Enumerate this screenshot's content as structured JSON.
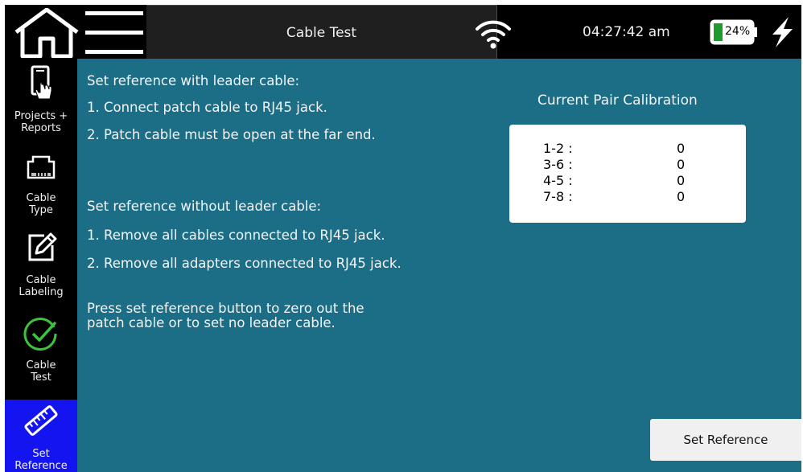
{
  "header": {
    "title": "Cable Test",
    "time": "04:27:42 am",
    "battery_percent": "24%",
    "battery_level": 0.24,
    "icons": [
      "home-icon",
      "hamburger-menu-icon",
      "wifi-icon",
      "battery-icon",
      "charging-bolt-icon"
    ]
  },
  "sidebar": {
    "items": [
      {
        "label": "Projects + Reports",
        "icon": "projects-reports-icon"
      },
      {
        "label": "Cable Type",
        "icon": "rj45-jack-icon"
      },
      {
        "label": "Cable Labeling",
        "icon": "edit-label-icon"
      },
      {
        "label": "Cable Test",
        "icon": "check-circle-icon"
      },
      {
        "label": "Set Reference",
        "icon": "ruler-icon",
        "active": true
      }
    ]
  },
  "instructions": {
    "with_leader_heading": "Set reference with leader cable:",
    "with_leader_step1": "1. Connect patch cable to RJ45 jack.",
    "with_leader_step2": "2. Patch cable must be open at the far end.",
    "without_leader_heading": "Set reference without leader cable:",
    "without_leader_step1": "1. Remove all cables connected to RJ45 jack.",
    "without_leader_step2": "2. Remove all adapters connected to RJ45 jack.",
    "note_line1": "Press set reference button to zero out the",
    "note_line2": "patch cable or to set no leader cable."
  },
  "calibration": {
    "title": "Current Pair Calibration",
    "pairs": [
      {
        "pair": "1-2 :",
        "value": "0"
      },
      {
        "pair": "3-6 :",
        "value": "0"
      },
      {
        "pair": "4-5 :",
        "value": "0"
      },
      {
        "pair": "7-8 :",
        "value": "0"
      }
    ]
  },
  "actions": {
    "set_reference_label": "Set Reference"
  },
  "colors": {
    "main_background": "#1c6d86",
    "sidebar_active": "#1414f0",
    "battery_fill": "#1e9a2e",
    "check_green": "#3cc43c"
  }
}
